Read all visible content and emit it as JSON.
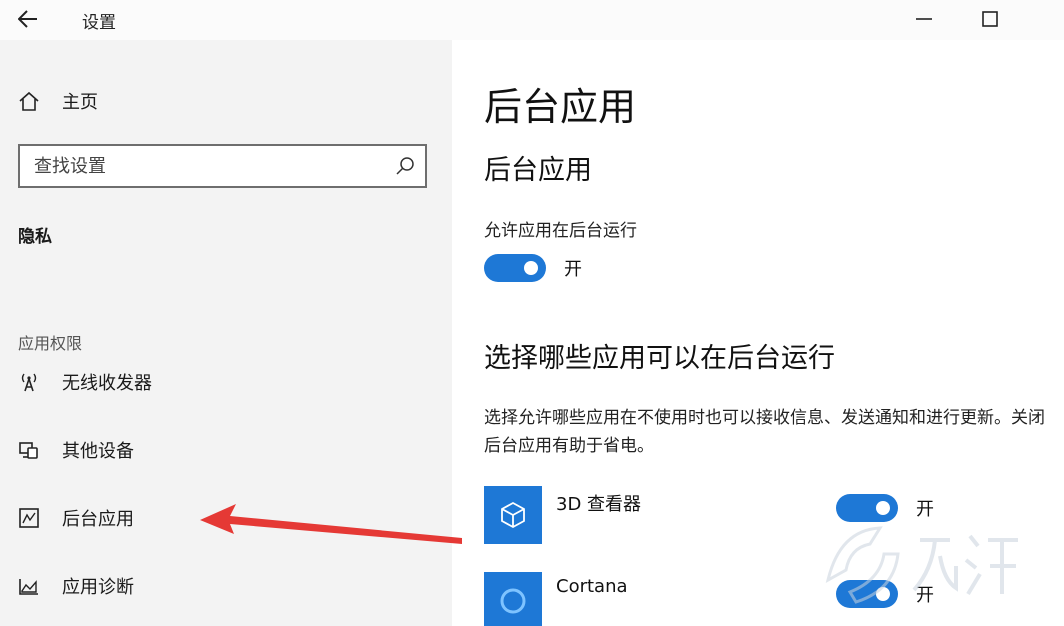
{
  "window": {
    "title": "设置",
    "back_icon": "back-arrow-icon",
    "controls": [
      "minimize-icon",
      "maximize-icon"
    ]
  },
  "sidebar": {
    "home_label": "主页",
    "search_placeholder": "查找设置",
    "section_title": "隐私",
    "group_label": "应用权限",
    "items": [
      {
        "label": "无线收发器",
        "icon": "radio-antenna-icon"
      },
      {
        "label": "其他设备",
        "icon": "other-devices-icon"
      },
      {
        "label": "后台应用",
        "icon": "background-apps-icon"
      },
      {
        "label": "应用诊断",
        "icon": "app-diagnostics-icon"
      }
    ]
  },
  "main": {
    "page_title": "后台应用",
    "subtitle": "后台应用",
    "allow_label": "允许应用在后台运行",
    "allow_state": "开",
    "choose_title": "选择哪些应用可以在后台运行",
    "description": "选择允许哪些应用在不使用时也可以接收信息、发送通知和进行更新。关闭后台应用有助于省电。",
    "apps": [
      {
        "name": "3D 查看器",
        "state": "开",
        "icon": "3d-cube-icon"
      },
      {
        "name": "Cortana",
        "state": "开",
        "icon": "cortana-circle-icon"
      }
    ]
  },
  "colors": {
    "accent": "#1e78d6",
    "sidebar_bg": "#f3f3f3",
    "annotation_arrow": "#e53935"
  }
}
